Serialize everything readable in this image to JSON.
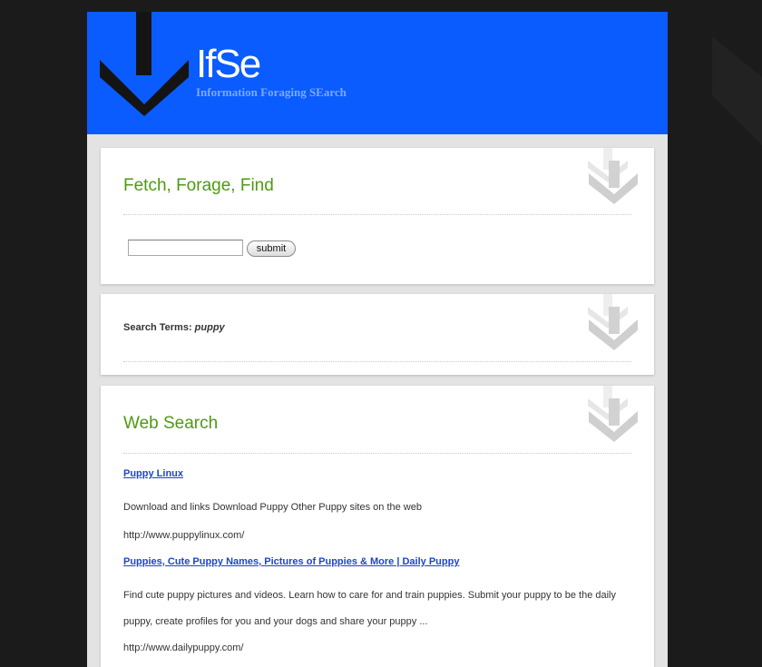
{
  "header": {
    "logo_text": "IfSe",
    "tagline": "Information Foraging SEarch"
  },
  "fetch_panel": {
    "title": "Fetch, Forage, Find",
    "search_value": "",
    "submit_label": "submit"
  },
  "terms_panel": {
    "label": "Search Terms:",
    "term": "puppy"
  },
  "web_search": {
    "title": "Web Search",
    "results": [
      {
        "title": "Puppy Linux",
        "description": "Download and links Download Puppy Other Puppy sites on the web",
        "url": "http://www.puppylinux.com/"
      },
      {
        "title": "Puppies, Cute Puppy Names, Pictures of Puppies & More | Daily Puppy",
        "description": "Find cute puppy pictures and videos. Learn how to care for and train puppies. Submit your puppy to be the daily puppy, create profiles for you and your dogs and share your puppy ...",
        "url": "http://www.dailypuppy.com/"
      }
    ]
  },
  "colors": {
    "header_blue": "#0a5cff",
    "title_green": "#4e9a10",
    "link_blue": "#1a47c9",
    "background": "#1b1b1b"
  }
}
